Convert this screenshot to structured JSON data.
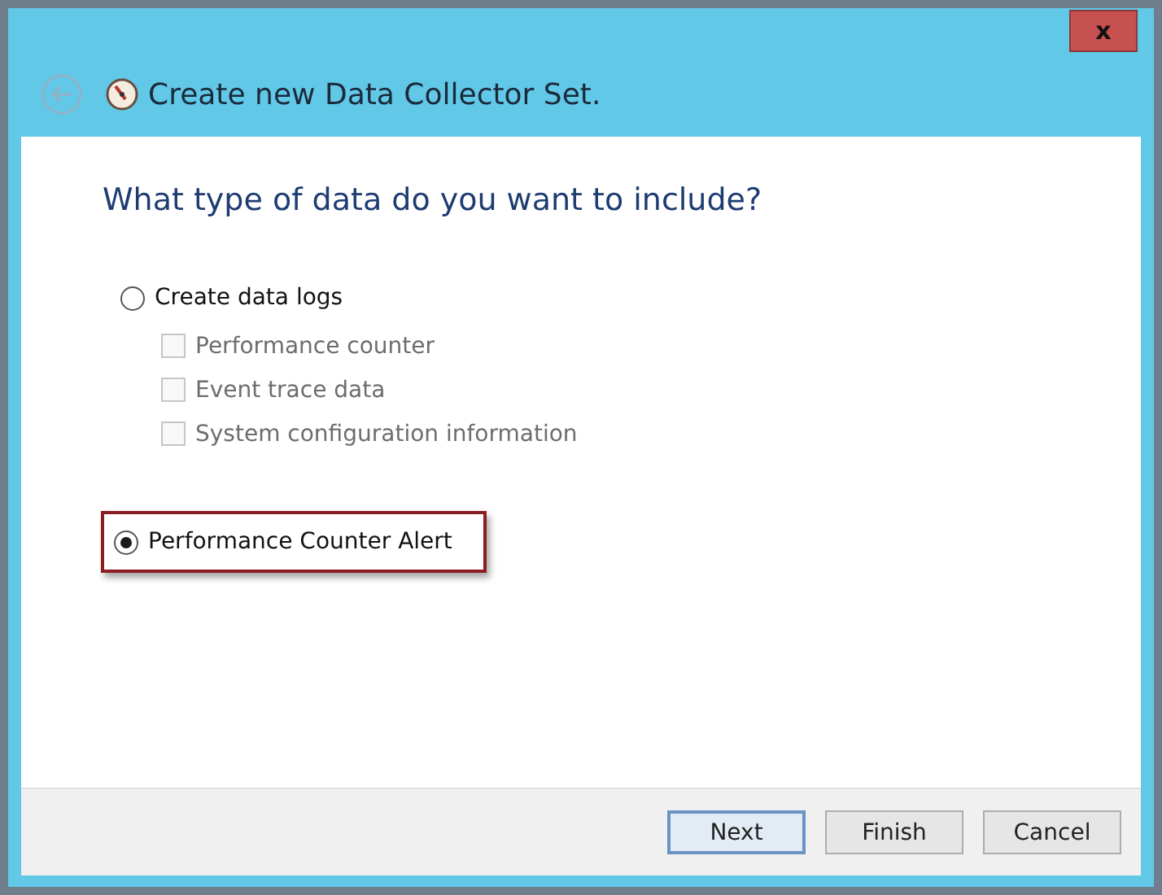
{
  "window": {
    "title": "Create new Data Collector Set.",
    "close_button": "x"
  },
  "heading": "What type of data do you want to include?",
  "options": [
    {
      "kind": "radio",
      "label": "Create data logs",
      "selected": false,
      "highlighted": false,
      "children": [
        {
          "kind": "checkbox",
          "label": "Performance counter",
          "checked": false,
          "disabled": true
        },
        {
          "kind": "checkbox",
          "label": "Event trace data",
          "checked": false,
          "disabled": true
        },
        {
          "kind": "checkbox",
          "label": "System configuration information",
          "checked": false,
          "disabled": true
        }
      ]
    },
    {
      "kind": "radio",
      "label": "Performance Counter Alert",
      "selected": true,
      "highlighted": true
    }
  ],
  "buttons": [
    {
      "label": "Next",
      "default": true
    },
    {
      "label": "Finish",
      "default": false
    },
    {
      "label": "Cancel",
      "default": false
    }
  ]
}
